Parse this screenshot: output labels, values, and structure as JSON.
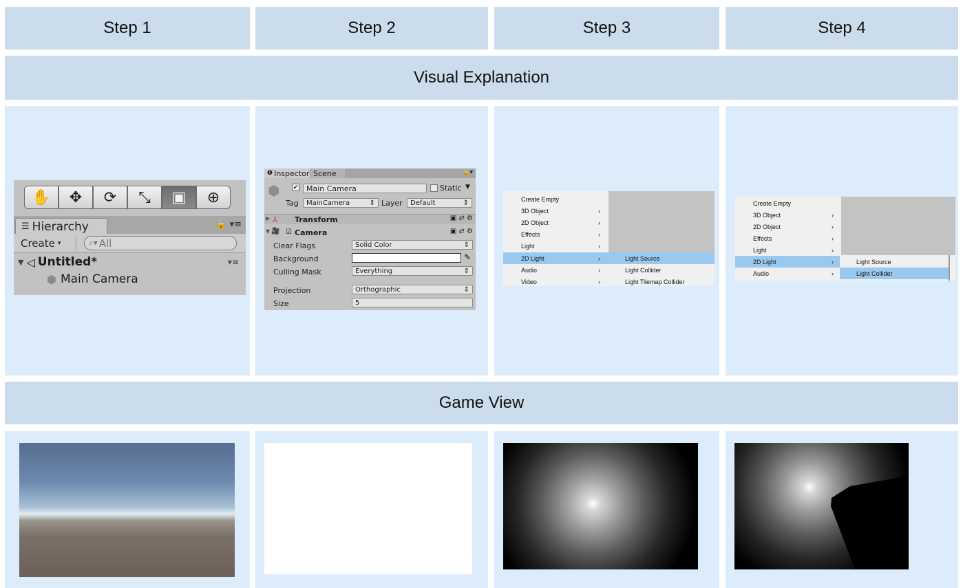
{
  "steps": [
    "Step 1",
    "Step 2",
    "Step 3",
    "Step 4"
  ],
  "sections": {
    "visual": "Visual Explanation",
    "game": "Game View"
  },
  "step1": {
    "toolbar_icons": [
      "hand-icon",
      "move-icon",
      "rotate-icon",
      "scale-icon",
      "rect-icon",
      "transform-icon"
    ],
    "hierarchy_tab": "Hierarchy",
    "create_label": "Create",
    "search_value": "All",
    "scene_name": "Untitled*",
    "object_name": "Main Camera"
  },
  "step2": {
    "tab_inspector": "Inspector",
    "tab_scene": "Scene",
    "object_name": "Main Camera",
    "static_label": "Static",
    "tag_label": "Tag",
    "tag_value": "MainCamera",
    "layer_label": "Layer",
    "layer_value": "Default",
    "transform_label": "Transform",
    "camera_label": "Camera",
    "clear_flags_label": "Clear Flags",
    "clear_flags_value": "Solid Color",
    "background_label": "Background",
    "culling_mask_label": "Culling Mask",
    "culling_mask_value": "Everything",
    "projection_label": "Projection",
    "projection_value": "Orthographic",
    "size_label": "Size",
    "size_value": "5"
  },
  "step3": {
    "menu_items": [
      "Create Empty",
      "3D Object",
      "2D Object",
      "Effects",
      "Light",
      "2D Light",
      "Audio",
      "Video"
    ],
    "submenu_items": [
      "Light Source",
      "Light Collider",
      "Light Tilemap Collider"
    ],
    "highlighted_item": "2D Light",
    "highlighted_sub": "Light Source"
  },
  "step4": {
    "menu_items": [
      "Create Empty",
      "3D Object",
      "2D Object",
      "Effects",
      "Light",
      "2D Light",
      "Audio"
    ],
    "submenu_items": [
      "Light Source",
      "Light Collider"
    ],
    "highlighted_item": "2D Light",
    "highlighted_sub": "Light Collider"
  },
  "colors": {
    "header_bg": "#cbdcec",
    "panel_bg": "#ddecfb",
    "menu_highlight": "#99c9ef",
    "unity_gray": "#c2c2c2"
  }
}
